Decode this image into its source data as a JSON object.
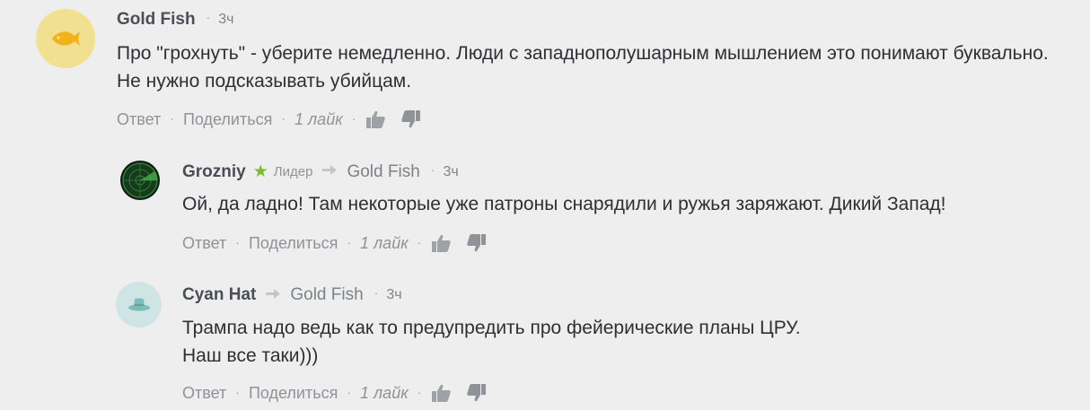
{
  "comments": [
    {
      "author": "Gold Fish",
      "time": "3ч",
      "text": "Про \"грохнуть\" - уберите немедленно. Люди с западнополушарным мышлением это понимают буквально. Не нужно подсказывать убийцам.",
      "actions": {
        "reply": "Ответ",
        "share": "Поделиться",
        "likes": "1 лайк"
      },
      "avatar_icon": "fish-icon",
      "avatar_color": "#f1e08f"
    },
    {
      "author": "Grozniy",
      "badge": "Лидер",
      "reply_to": "Gold Fish",
      "time": "3ч",
      "text": "Ой, да ладно! Там некоторые уже патроны снарядили и ружья заряжают. Дикий Запад!",
      "actions": {
        "reply": "Ответ",
        "share": "Поделиться",
        "likes": "1 лайк"
      },
      "avatar_icon": "radar-icon"
    },
    {
      "author": "Cyan Hat",
      "reply_to": "Gold Fish",
      "time": "3ч",
      "text": "Трампа надо ведь как то предупредить про фейерические планы ЦРУ.\nНаш все таки)))",
      "actions": {
        "reply": "Ответ",
        "share": "Поделиться",
        "likes": "1 лайк"
      },
      "avatar_icon": "hat-icon",
      "avatar_color": "#cfe4e4"
    }
  ],
  "separator": "·",
  "colors": {
    "background": "#eeeeee",
    "leader_star": "#7bbd2a",
    "muted_text": "#8f9398"
  }
}
